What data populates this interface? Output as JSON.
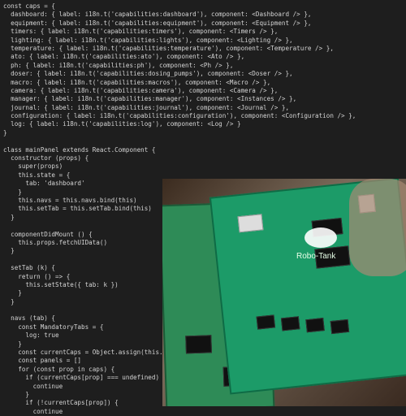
{
  "editor": {
    "code_lines": [
      "const caps = {",
      "  dashboard: { label: i18n.t('capabilities:dashboard'), component: <Dashboard /> },",
      "  equipment: { label: i18n.t('capabilities:equipment'), component: <Equipment /> },",
      "  timers: { label: i18n.t('capabilities:timers'), component: <Timers /> },",
      "  lighting: { label: i18n.t('capabilities:lights'), component: <Lighting /> },",
      "  temperature: { label: i18n.t('capabilities:temperature'), component: <Temperature /> },",
      "  ato: { label: i18n.t('capabilities:ato'), component: <Ato /> },",
      "  ph: { label: i18n.t('capabilities:ph'), component: <Ph /> },",
      "  doser: { label: i18n.t('capabilities:dosing_pumps'), component: <Doser /> },",
      "  macro: { label: i18n.t('capabilities:macros'), component: <Macro /> },",
      "  camera: { label: i18n.t('capabilities:camera'), component: <Camera /> },",
      "  manager: { label: i18n.t('capabilities:manager'), component: <Instances /> },",
      "  journal: { label: i18n.t('capabilities:journal'), component: <Journal /> },",
      "  configuration: { label: i18n.t('capabilities:configuration'), component: <Configuration /> },",
      "  log: { label: i18n.t('capabilities:log'), component: <Log /> }",
      "}",
      "",
      "class mainPanel extends React.Component {",
      "  constructor (props) {",
      "    super(props)",
      "    this.state = {",
      "      tab: 'dashboard'",
      "    }",
      "    this.navs = this.navs.bind(this)",
      "    this.setTab = this.setTab.bind(this)",
      "  }",
      "",
      "  componentDidMount () {",
      "    this.props.fetchUIData()",
      "  }",
      "",
      "  setTab (k) {",
      "    return () => {",
      "      this.setState({ tab: k })",
      "    }",
      "  }",
      "",
      "  navs (tab) {",
      "    const MandatoryTabs = {",
      "      log: true",
      "    }",
      "    const currentCaps = Object.assign(this.prop",
      "    const panels = []",
      "    for (const prop in caps) {",
      "      if (currentCaps[prop] === undefined) {",
      "        continue",
      "      }",
      "      if (!currentCaps[prop]) {",
      "        continue"
    ]
  },
  "photo": {
    "board_label": "Robo-Tank"
  }
}
